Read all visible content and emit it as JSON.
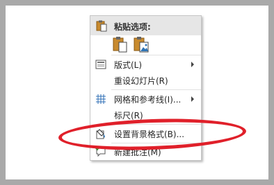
{
  "context_menu": {
    "paste_header": "粘贴选项:",
    "paste_options": [
      {
        "name": "use-destination-theme",
        "icon": "clipboard-icon"
      },
      {
        "name": "picture",
        "icon": "clipboard-picture-icon"
      }
    ],
    "items": [
      {
        "label": "版式(L)",
        "icon": "layout-icon",
        "submenu": true
      },
      {
        "label": "重设幻灯片(R)",
        "icon": "",
        "submenu": false
      },
      {
        "label": "网格和参考线(I)...",
        "icon": "grid-icon",
        "submenu": true
      },
      {
        "label": "标尺(R)",
        "icon": "",
        "submenu": false
      },
      {
        "label": "设置背景格式(B)...",
        "icon": "format-background-icon",
        "submenu": false
      },
      {
        "label": "新建批注(M)",
        "icon": "new-comment-icon",
        "submenu": false
      }
    ]
  },
  "annotation": {
    "color": "#e0202a",
    "shape": "ellipse"
  }
}
